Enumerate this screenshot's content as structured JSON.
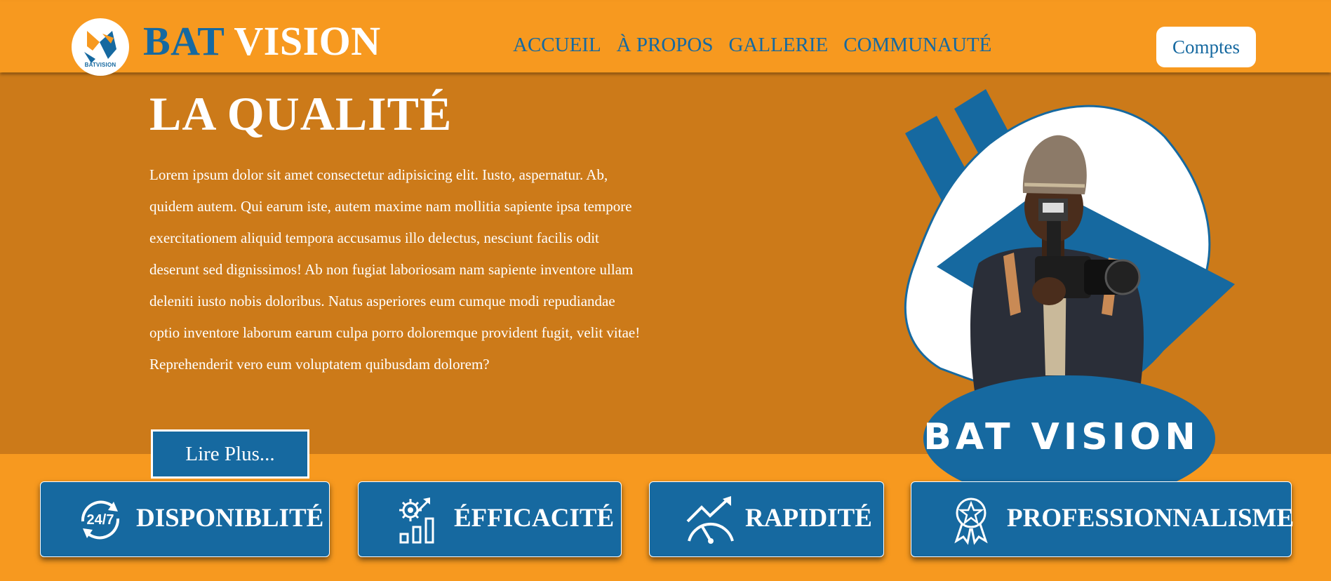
{
  "header": {
    "logo_caption": "BATVISION",
    "brand_part1": "BAT",
    "brand_part2": "VISION",
    "nav": [
      "ACCUEIL",
      "À PROPOS",
      "GALLERIE",
      "COMMUNAUTÉ"
    ],
    "accounts_label": "Comptes"
  },
  "hero": {
    "title": "LA QUALITÉ",
    "text": "Lorem ipsum dolor sit amet consectetur adipisicing elit. Iusto, aspernatur. Ab, quidem autem. Qui earum iste, autem maxime nam mollitia sapiente ipsa tempore exercitationem aliquid tempora accusamus illo delectus, nesciunt facilis odit deserunt sed dignissimos! Ab non fugiat laboriosam nam sapiente inventore ullam deleniti iusto nobis doloribus. Natus asperiores eum cumque modi repudiandae optio inventore laborum earum culpa porro doloremque provident fugit, velit vitae! Reprehenderit vero eum voluptatem quibusdam dolorem?",
    "button_label": "Lire Plus...",
    "image_label": "BAT VISION"
  },
  "features": [
    {
      "label": "DISPONIBLITÉ",
      "icon": "clock-24-7-icon"
    },
    {
      "label": "ÉFFICACITÉ",
      "icon": "gear-growth-chart-icon"
    },
    {
      "label": "RAPIDITÉ",
      "icon": "speedometer-trend-icon"
    },
    {
      "label": "PROFESSIONNALISME",
      "icon": "award-ribbon-icon"
    }
  ],
  "colors": {
    "orange": "#f7991f",
    "dark_orange": "#cc7a19",
    "blue": "#1669a0",
    "white": "#ffffff"
  }
}
